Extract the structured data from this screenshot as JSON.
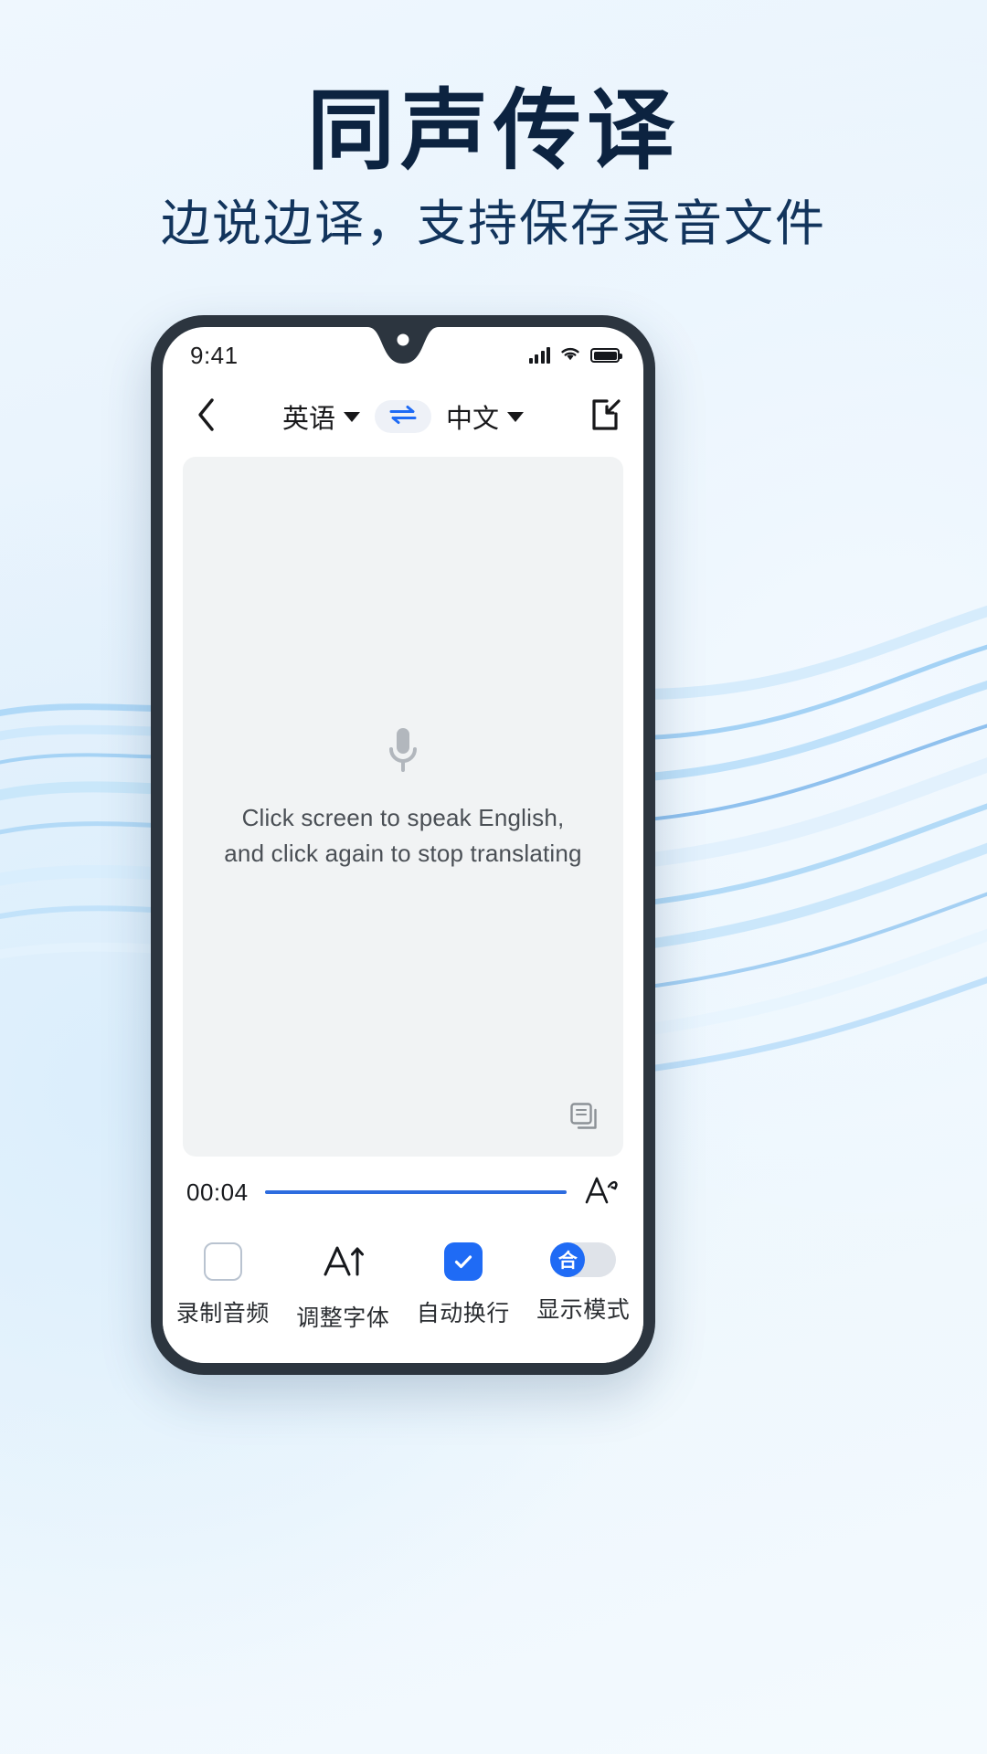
{
  "promo": {
    "headline": "同声传译",
    "subhead": "边说边译，支持保存录音文件"
  },
  "phone": {
    "status": {
      "time": "9:41",
      "signal_icon": "cellular-signal-icon",
      "wifi_icon": "wifi-icon",
      "battery_icon": "battery-icon"
    },
    "navbar": {
      "back_icon": "back-chevron-icon",
      "source_language": "英语",
      "target_language": "中文",
      "swap_icon": "swap-arrows-icon",
      "fullscreen_icon": "fullscreen-icon"
    },
    "content": {
      "mic_icon": "microphone-icon",
      "hint_line1": "Click screen to speak English,",
      "hint_line2": "and click again to stop translating",
      "copy_icon": "copy-icon"
    },
    "progress": {
      "elapsed": "00:04",
      "percent": 100,
      "font_size_icon": "font-resize-icon"
    },
    "toolbar": [
      {
        "label": "录制音频",
        "icon": "checkbox-unchecked-icon",
        "state": "off"
      },
      {
        "label": "调整字体",
        "icon": "font-increase-icon",
        "state": "none"
      },
      {
        "label": "自动换行",
        "icon": "checkbox-checked-icon",
        "state": "on"
      },
      {
        "label": "显示模式",
        "icon": "display-mode-toggle-icon",
        "state": "left"
      }
    ]
  },
  "colors": {
    "accent": "#1f6bf5",
    "progress": "#2d6cdf",
    "headline": "#0c2340",
    "bezel": "#2c353f",
    "card": "#f1f3f4"
  }
}
